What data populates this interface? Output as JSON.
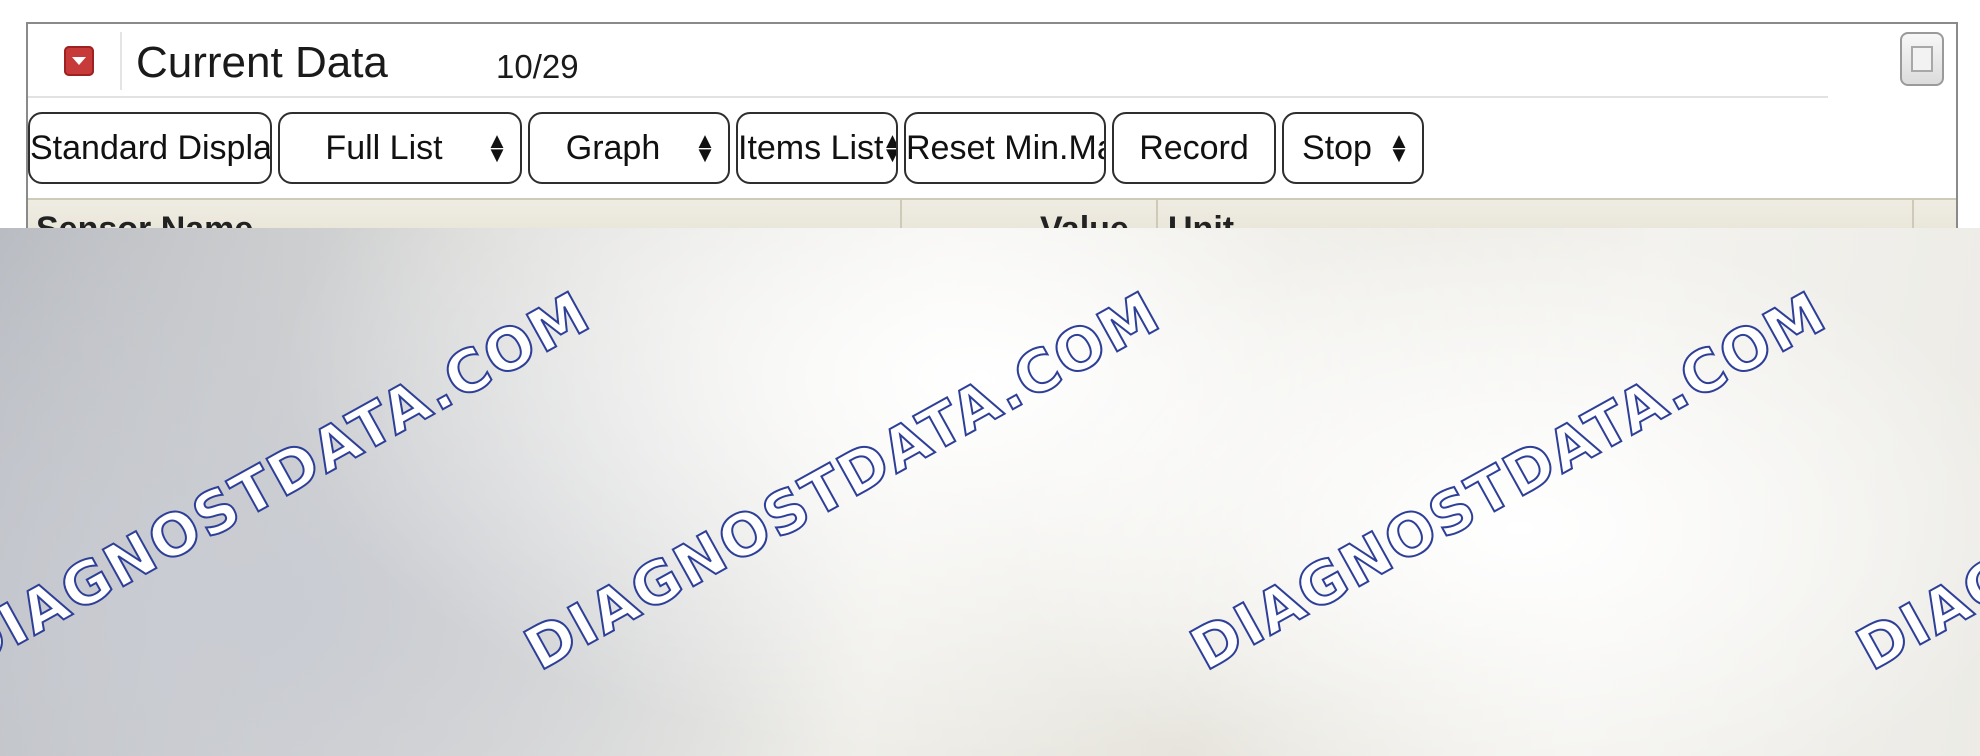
{
  "window": {
    "title": "Current Data",
    "count": "10/29"
  },
  "toolbar": {
    "standard_display": "Standard Display",
    "full_list": "Full List",
    "graph": "Graph",
    "items_list": "Items List",
    "reset_min_max": "Reset Min.Max.",
    "record": "Record",
    "stop": "Stop",
    "select_arrows": "▲▼"
  },
  "table": {
    "columns": [
      "Sensor Name",
      "Value",
      "Unit"
    ]
  },
  "watermark": {
    "text": "DIAGNOSTDATA.COM"
  },
  "icons": {
    "collapse": "collapse-arrow-icon",
    "restore": "restore-window-icon",
    "select": "updown-arrows-icon"
  },
  "colors": {
    "collapse_button": "#c63a3a",
    "header_bg": "#ebe8dc",
    "watermark_outline": "#2e3f98"
  }
}
